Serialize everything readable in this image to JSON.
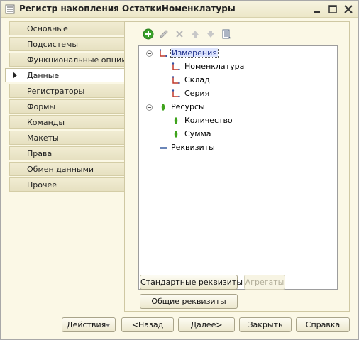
{
  "window": {
    "title": "Регистр накопления ОстаткиНоменклатуры",
    "icon": "accumulation-register-icon",
    "minimize_icon": "minimize-icon",
    "maximize_icon": "maximize-icon",
    "close_icon": "close-icon"
  },
  "sidebar": {
    "items": [
      {
        "label": "Основные",
        "active": false
      },
      {
        "label": "Подсистемы",
        "active": false
      },
      {
        "label": "Функциональные опции",
        "active": false
      },
      {
        "label": "Данные",
        "active": true
      },
      {
        "label": "Регистраторы",
        "active": false
      },
      {
        "label": "Формы",
        "active": false
      },
      {
        "label": "Команды",
        "active": false
      },
      {
        "label": "Макеты",
        "active": false
      },
      {
        "label": "Права",
        "active": false
      },
      {
        "label": "Обмен данными",
        "active": false
      },
      {
        "label": "Прочее",
        "active": false
      }
    ]
  },
  "toolbar": {
    "icons": [
      "add-icon",
      "edit-icon",
      "delete-icon",
      "move-up-icon",
      "move-down-icon",
      "list-icon"
    ]
  },
  "tree": {
    "dimensions_group": "Измерения",
    "dimensions": [
      "Номенклатура",
      "Склад",
      "Серия"
    ],
    "resources_group": "Ресурсы",
    "resources": [
      "Количество",
      "Сумма"
    ],
    "attributes_group": "Реквизиты"
  },
  "panel_buttons": {
    "standard_attributes": "Стандартные реквизиты",
    "aggregates": "Агрегаты",
    "common_attributes": "Общие реквизиты"
  },
  "footer": {
    "actions": "Действия",
    "back": "<Назад",
    "next": "Далее>",
    "close": "Закрыть",
    "help": "Справка"
  },
  "colors": {
    "window_bg": "#fbf8e6",
    "dimension_icon": "#c0392b",
    "resource_icon": "#3fa31d",
    "add_icon": "#39a12a"
  }
}
